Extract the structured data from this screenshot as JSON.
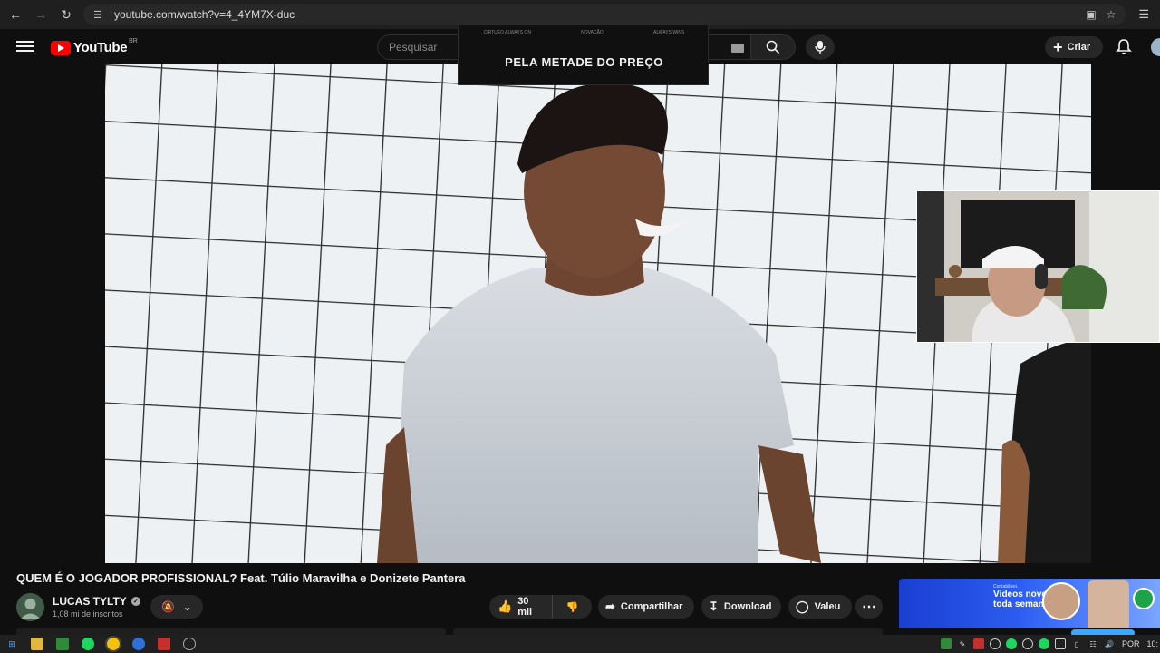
{
  "browser": {
    "url": "youtube.com/watch?v=4_4YM7X-duc",
    "back_icon": "arrow-left-icon",
    "forward_icon": "arrow-right-icon",
    "reload_icon": "reload-icon"
  },
  "masthead": {
    "logo_text": "YouTube",
    "country_code": "BR",
    "search_placeholder": "Pesquisar",
    "create_label": "Criar"
  },
  "ad_overlay": {
    "headline": "PELA METADE DO PREÇO",
    "strip_items": [
      "CIRTUÉO ALWAYS ON",
      "NOVAÇÃO",
      "ALWAYS WINS"
    ]
  },
  "video": {
    "title": "QUEM É O JOGADOR PROFISSIONAL? Feat. Túlio Maravilha e Donizete Pantera",
    "channel": "LUCAS TYLTY",
    "subscribers": "1,08 mi de inscritos",
    "likes": "30 mil",
    "share_label": "Compartilhar",
    "download_label": "Download",
    "thanks_label": "Valeu"
  },
  "side_ad": {
    "brand": "Contabilizei.",
    "headline_line1": "Vídeos novos",
    "headline_line2": "toda semana."
  },
  "taskbar": {
    "language": "POR",
    "clock": "10:"
  },
  "colors": {
    "background": "#0f0f0f",
    "youtube_red": "#ff0000",
    "pill": "#272727",
    "side_ad_blue": "#2b5cf0"
  }
}
